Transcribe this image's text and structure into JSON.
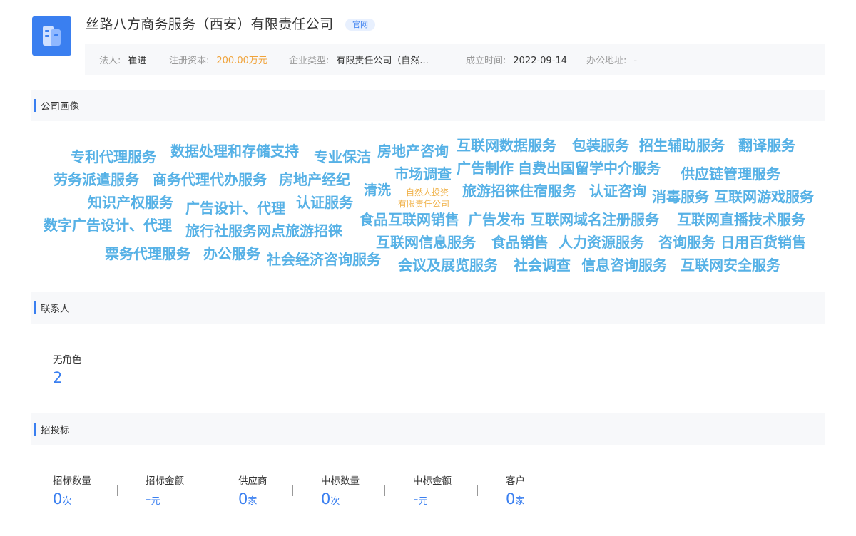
{
  "company": {
    "name": "丝路八方商务服务（西安）有限责任公司",
    "badge": "官网",
    "info": {
      "legal_person": {
        "label": "法人:",
        "value": "崔进"
      },
      "capital": {
        "label": "注册资本:",
        "value": "200.00万元"
      },
      "type": {
        "label": "企业类型:",
        "value": "有限责任公司（自然..."
      },
      "founded": {
        "label": "成立时间:",
        "value": "2022-09-14"
      },
      "address": {
        "label": "办公地址:",
        "value": "-"
      }
    }
  },
  "sections": {
    "portrait": "公司画像",
    "contacts": "联系人",
    "bidding": "招投标"
  },
  "word_cloud": [
    "专利代理服务",
    "数据处理和存储支持",
    "专业保洁",
    "房地产咨询",
    "互联网数据服务",
    "包装服务",
    "招生辅助服务",
    "翻译服务",
    "劳务派遣服务",
    "商务代理代办服务",
    "房地产经纪",
    "市场调查",
    "广告制作",
    "自费出国留学中介服务",
    "供应链管理服务",
    "知识产权服务",
    "广告设计、代理",
    "认证服务",
    "清洗",
    "自然人投资",
    "旅游招徕住宿服务",
    "认证咨询",
    "消毒服务",
    "互联网游戏服务",
    "有限责任公司",
    "数字广告设计、代理",
    "旅行社服务网点旅游招徕",
    "食品互联网销售",
    "广告发布",
    "互联网域名注册服务",
    "互联网直播技术服务",
    "互联网信息服务",
    "食品销售",
    "人力资源服务",
    "咨询服务",
    "日用百货销售",
    "票务代理服务",
    "办公服务",
    "社会经济咨询服务",
    "会议及展览服务",
    "社会调查",
    "信息咨询服务",
    "互联网安全服务"
  ],
  "contacts": {
    "role_label": "无角色",
    "role_count": "2"
  },
  "bidding": [
    {
      "label": "招标数量",
      "value": "0",
      "unit": "次"
    },
    {
      "label": "招标金额",
      "value": "-",
      "unit": "元"
    },
    {
      "label": "供应商",
      "value": "0",
      "unit": "家"
    },
    {
      "label": "中标数量",
      "value": "0",
      "unit": "次"
    },
    {
      "label": "中标金额",
      "value": "-",
      "unit": "元"
    },
    {
      "label": "客户",
      "value": "0",
      "unit": "家"
    }
  ],
  "colors": {
    "accent": "#3a7ff0",
    "cloud_word": "#56b1e6",
    "cloud_highlight": "#f0b24a",
    "capital_value": "#f0a33a"
  }
}
